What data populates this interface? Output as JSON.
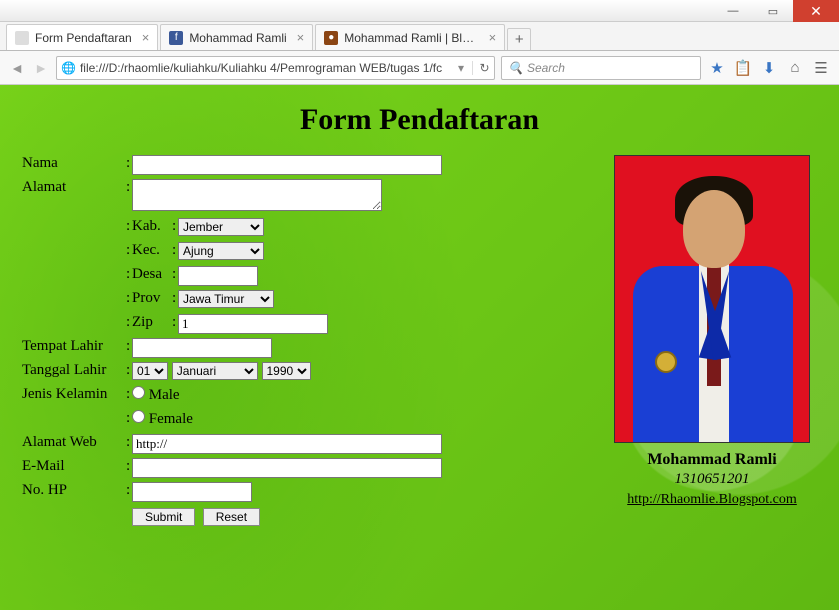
{
  "window": {
    "tabs": [
      {
        "title": "Form Pendaftaran",
        "type": "page"
      },
      {
        "title": "Mohammad Ramli",
        "type": "fb"
      },
      {
        "title": "Mohammad Ramli | Blog A...",
        "type": "blog"
      }
    ],
    "url": "file:///D:/rhaomlie/kuliahku/Kuliahku 4/Pemrograman WEB/tugas 1/fc",
    "search_placeholder": "Search"
  },
  "page": {
    "heading": "Form Pendaftaran",
    "labels": {
      "nama": "Nama",
      "alamat": "Alamat",
      "kab": "Kab.",
      "kec": "Kec.",
      "desa": "Desa",
      "prov": "Prov",
      "zip": "Zip",
      "tempat_lahir": "Tempat Lahir",
      "tanggal_lahir": "Tanggal Lahir",
      "jenis_kelamin": "Jenis Kelamin",
      "male": "Male",
      "female": "Female",
      "alamat_web": "Alamat Web",
      "email": "E-Mail",
      "nohp": "No. HP",
      "submit": "Submit",
      "reset": "Reset"
    },
    "values": {
      "kab": "Jember",
      "kec": "Ajung",
      "prov": "Jawa Timur",
      "zip": "1",
      "tgl_day": "01",
      "tgl_month": "Januari",
      "tgl_year": "1990",
      "alamat_web": "http://"
    },
    "profile": {
      "name": "Mohammad Ramli",
      "nim": "1310651201",
      "link": "http://Rhaomlie.Blogspot.com"
    }
  }
}
